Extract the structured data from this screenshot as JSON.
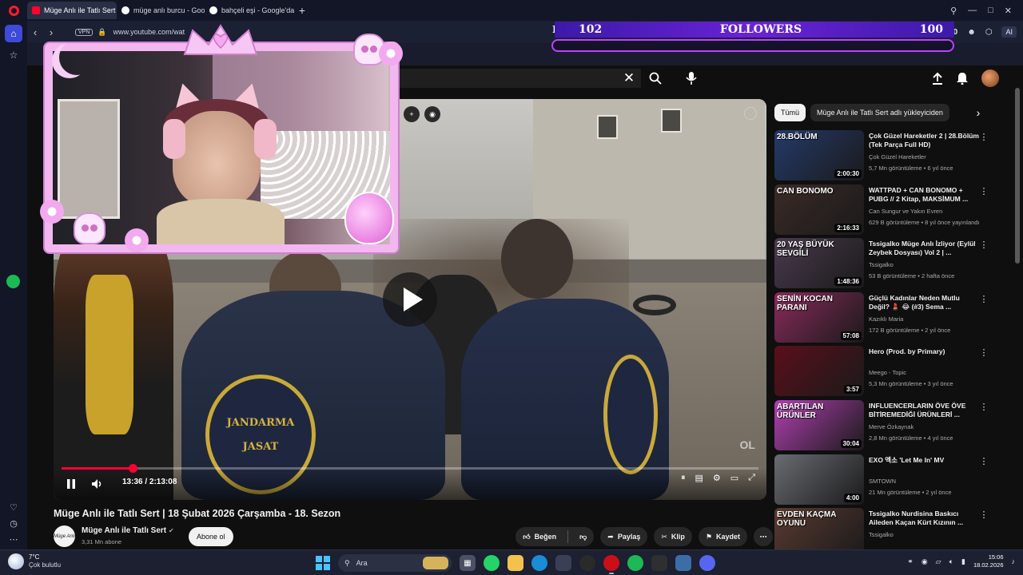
{
  "browser": {
    "tabs": [
      {
        "label": "Müge Anlı ile Tatlı Sert",
        "active": true,
        "favicon": "youtube-icon"
      },
      {
        "label": "müge anlı burcu - Google",
        "active": false,
        "favicon": "google-icon"
      },
      {
        "label": "bahçeli eşi - Google'da Ar",
        "active": false,
        "favicon": "google-icon"
      }
    ],
    "new_tab": "+",
    "vpn_label": "VPN",
    "url": "www.youtube.com/wat",
    "money_left": "$0",
    "money_right": "$100",
    "ai_label": "AI"
  },
  "stream_overlay": {
    "followers_current": "102",
    "followers_label": "FOLLOWERS",
    "followers_goal": "100",
    "hidden_prefix": "D"
  },
  "player": {
    "current_time": "13:36",
    "total_time": "2:13:08",
    "time_display": "13:36 / 2:13:08",
    "progress_fraction": 0.102,
    "badge_text_1": "JANDARMA",
    "badge_text_2": "JASAT",
    "watermark": "OL"
  },
  "video": {
    "title": "Müge Anlı ile Tatlı Sert | 18 Şubat 2026 Çarşamba - 18. Sezon",
    "channel": "Müge Anlı ile Tatlı Sert",
    "subscribers": "3,31 Mn abone",
    "subscribe_label": "Abone ol",
    "avatar_text": "Müge Anlı",
    "actions": {
      "like": "Beğen",
      "share": "Paylaş",
      "clip": "Klip",
      "save": "Kaydet"
    }
  },
  "chips": [
    {
      "label": "Tümü",
      "active": true
    },
    {
      "label": "Müge Anlı ile Tatlı Sert adlı yükleyiciden",
      "active": false
    }
  ],
  "recommendations": [
    {
      "title": "Çok Güzel Hareketler 2 | 28.Bölüm (Tek Parça Full HD)",
      "channel": "Çok Güzel Hareketler",
      "meta": "5,7 Mn görüntüleme • 6 yıl önce",
      "duration": "2:00:30",
      "thumb_text": "28.BÖLÜM",
      "color": "#243a6a"
    },
    {
      "title": "WATTPAD + CAN BONOMO + PUBG // 2 Kitap, MAKSİMUM ...",
      "channel": "Can Sungur ve Yakın Evren",
      "meta": "629 B görüntüleme • 8 yıl önce yayınlandı",
      "duration": "2:16:33",
      "thumb_text": "CAN BONOMO",
      "color": "#3a2a26"
    },
    {
      "title": "Tssigalko Müge Anlı İzliyor (Eylül Zeybek Dosyası) Vol 2 | ...",
      "channel": "Tssigalko",
      "meta": "53 B görüntüleme • 2 hafta önce",
      "duration": "1:48:36",
      "thumb_text": "20 YAŞ BÜYÜK SEVGİLİ",
      "color": "#4a3a4e"
    },
    {
      "title": "Güçlü Kadınlar Neden Mutlu Değil? 💄 😂 (#3) Sema ...",
      "channel": "Kazıklı Maria",
      "meta": "172 B görüntüleme • 2 yıl önce",
      "duration": "57:08",
      "thumb_text": "SENİN KOCAN PARANI",
      "color": "#8a2a5a"
    },
    {
      "title": "Hero (Prod. by Primary)",
      "channel": "Meego - Topic",
      "meta": "5,3 Mn görüntüleme • 3 yıl önce",
      "duration": "3:57",
      "thumb_text": "",
      "color": "#5a0f1a"
    },
    {
      "title": "INFLUENCERLARIN ÖVE ÖVE BİTİREMEDİĞİ ÜRÜNLERİ ...",
      "channel": "Merve Özkaynak",
      "meta": "2,8 Mn görüntüleme • 4 yıl önce",
      "duration": "30:04",
      "thumb_text": "ABARTILAN ÜRÜNLER",
      "color": "#b040b0"
    },
    {
      "title": "EXO 엑소 'Let Me In' MV",
      "channel": "SMTOWN",
      "meta": "21 Mn görüntüleme • 2 yıl önce",
      "duration": "4:00",
      "thumb_text": "",
      "color": "#6a6c72"
    },
    {
      "title": "Tssigalko Nurdisina Baskıcı Aileden Kaçan Kürt Kızının ...",
      "channel": "Tssigalko",
      "meta": "",
      "duration": "",
      "thumb_text": "EVDEN KAÇMA OYUNU",
      "color": "#5a3a30"
    }
  ],
  "taskbar": {
    "temperature": "7°C",
    "weather": "Çok bulutlu",
    "search_label": "Ara",
    "time": "15:06",
    "date": "18.02.2026"
  }
}
